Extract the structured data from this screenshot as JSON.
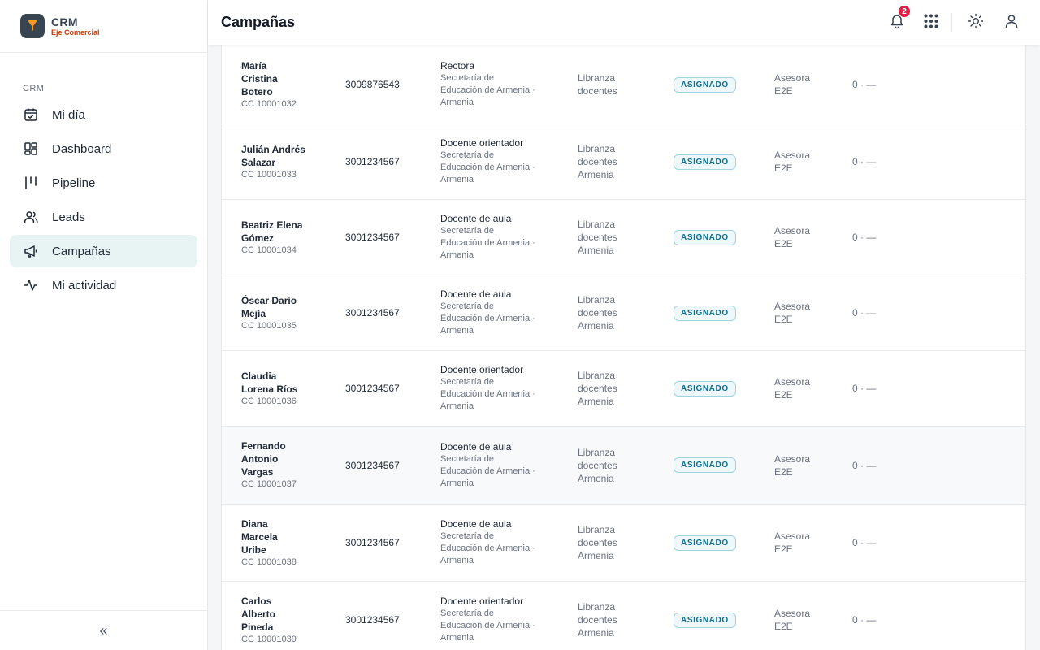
{
  "brand": {
    "name": "CRM",
    "subtitle": "Eje Comercial"
  },
  "sidebar": {
    "section": "CRM",
    "items": [
      {
        "label": "Mi día",
        "icon": "calendar-check-icon"
      },
      {
        "label": "Dashboard",
        "icon": "dashboard-grid-icon"
      },
      {
        "label": "Pipeline",
        "icon": "pipeline-columns-icon"
      },
      {
        "label": "Leads",
        "icon": "users-icon"
      },
      {
        "label": "Campañas",
        "icon": "megaphone-icon",
        "active": true
      },
      {
        "label": "Mi actividad",
        "icon": "activity-pulse-icon"
      }
    ],
    "collapse_label": "«"
  },
  "header": {
    "title": "Campañas",
    "notifications_count": "2",
    "icons": [
      "bell-icon",
      "apps-grid-icon",
      "sun-icon",
      "user-icon"
    ]
  },
  "colors": {
    "accent_bg": "#e7f4f3",
    "badge": "#e11d48",
    "pill_text": "#0e6f8c",
    "pill_border": "#9fd3e0"
  },
  "rows": [
    {
      "name": [
        "María",
        "Cristina",
        "Botero"
      ],
      "cc": "CC 10001032",
      "phone": "3009876543",
      "role": "Rectora",
      "org": [
        "Secretaría de",
        "Educación de Armenia ·",
        "Armenia"
      ],
      "campaign": [
        "Libranza",
        "docentes"
      ],
      "status": "ASIGNADO",
      "advisor": [
        "Asesora",
        "E2E"
      ],
      "count": "0 · —"
    },
    {
      "name": [
        "Julián Andrés",
        "Salazar"
      ],
      "cc": "CC 10001033",
      "phone": "3001234567",
      "role": "Docente orientador",
      "org": [
        "Secretaría de",
        "Educación de Armenia ·",
        "Armenia"
      ],
      "campaign": [
        "Libranza",
        "docentes",
        "Armenia"
      ],
      "status": "ASIGNADO",
      "advisor": [
        "Asesora",
        "E2E"
      ],
      "count": "0 · —"
    },
    {
      "name": [
        "Beatriz Elena",
        "Gómez"
      ],
      "cc": "CC 10001034",
      "phone": "3001234567",
      "role": "Docente de aula",
      "org": [
        "Secretaría de",
        "Educación de Armenia ·",
        "Armenia"
      ],
      "campaign": [
        "Libranza",
        "docentes",
        "Armenia"
      ],
      "status": "ASIGNADO",
      "advisor": [
        "Asesora",
        "E2E"
      ],
      "count": "0 · —"
    },
    {
      "name": [
        "Óscar Darío",
        "Mejía"
      ],
      "cc": "CC 10001035",
      "phone": "3001234567",
      "role": "Docente de aula",
      "org": [
        "Secretaría de",
        "Educación de Armenia ·",
        "Armenia"
      ],
      "campaign": [
        "Libranza",
        "docentes",
        "Armenia"
      ],
      "status": "ASIGNADO",
      "advisor": [
        "Asesora",
        "E2E"
      ],
      "count": "0 · —"
    },
    {
      "name": [
        "Claudia",
        "Lorena Ríos"
      ],
      "cc": "CC 10001036",
      "phone": "3001234567",
      "role": "Docente orientador",
      "org": [
        "Secretaría de",
        "Educación de Armenia ·",
        "Armenia"
      ],
      "campaign": [
        "Libranza",
        "docentes",
        "Armenia"
      ],
      "status": "ASIGNADO",
      "advisor": [
        "Asesora",
        "E2E"
      ],
      "count": "0 · —"
    },
    {
      "name": [
        "Fernando",
        "Antonio",
        "Vargas"
      ],
      "cc": "CC 10001037",
      "phone": "3001234567",
      "role": "Docente de aula",
      "org": [
        "Secretaría de",
        "Educación de Armenia ·",
        "Armenia"
      ],
      "campaign": [
        "Libranza",
        "docentes",
        "Armenia"
      ],
      "status": "ASIGNADO",
      "advisor": [
        "Asesora",
        "E2E"
      ],
      "count": "0 · —"
    },
    {
      "name": [
        "Diana",
        "Marcela",
        "Uribe"
      ],
      "cc": "CC 10001038",
      "phone": "3001234567",
      "role": "Docente de aula",
      "org": [
        "Secretaría de",
        "Educación de Armenia ·",
        "Armenia"
      ],
      "campaign": [
        "Libranza",
        "docentes",
        "Armenia"
      ],
      "status": "ASIGNADO",
      "advisor": [
        "Asesora",
        "E2E"
      ],
      "count": "0 · —"
    },
    {
      "name": [
        "Carlos",
        "Alberto",
        "Pineda"
      ],
      "cc": "CC 10001039",
      "phone": "3001234567",
      "role": "Docente orientador",
      "org": [
        "Secretaría de",
        "Educación de Armenia ·",
        "Armenia"
      ],
      "campaign": [
        "Libranza",
        "docentes",
        "Armenia"
      ],
      "status": "ASIGNADO",
      "advisor": [
        "Asesora",
        "E2E"
      ],
      "count": "0 · —"
    }
  ]
}
